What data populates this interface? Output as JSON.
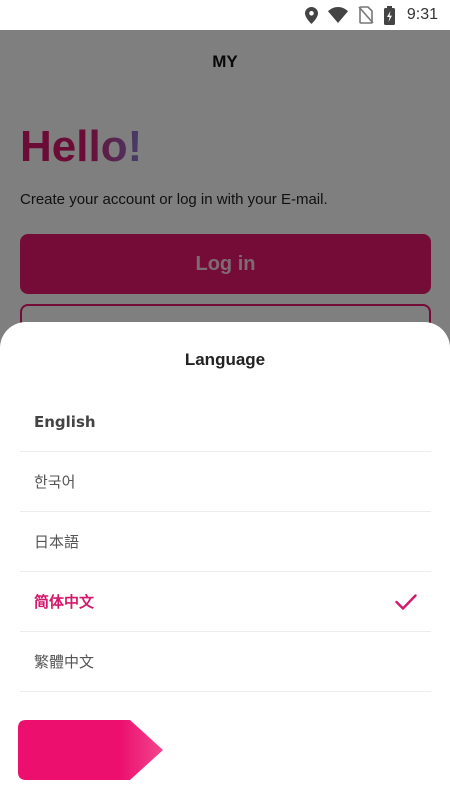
{
  "status_bar": {
    "time": "9:31",
    "icons": [
      "location-icon",
      "wifi-icon",
      "no-sim-icon",
      "battery-charging-icon"
    ]
  },
  "app": {
    "title": "MY",
    "greeting": "Hello!",
    "subtitle": "Create your account or log in with your E-mail.",
    "login_label": "Log in"
  },
  "colors": {
    "accent": "#e8196f",
    "selected_text": "#d4186c",
    "scrim": "rgba(0,0,0,0.5)"
  },
  "language_sheet": {
    "title": "Language",
    "selected_index": 3,
    "languages": [
      {
        "label": "English"
      },
      {
        "label": "한국어"
      },
      {
        "label": "日本語"
      },
      {
        "label": "简体中文"
      },
      {
        "label": "繁體中文"
      }
    ],
    "next_icon": "arrow-shape-icon"
  }
}
